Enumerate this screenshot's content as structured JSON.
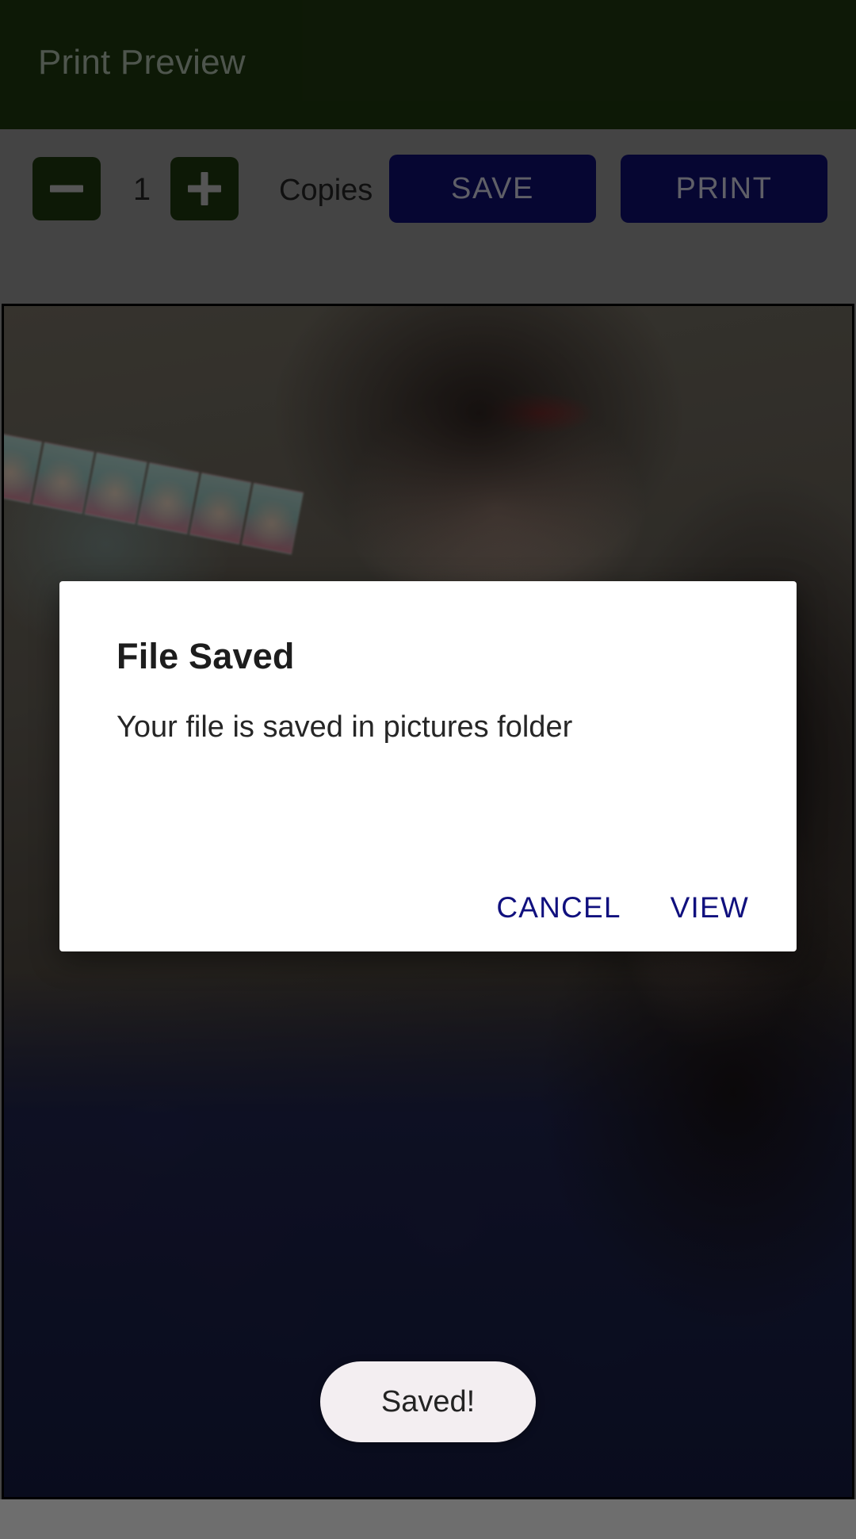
{
  "appbar": {
    "title": "Print Preview",
    "background_color": "#16290b",
    "title_color": "#7e8a7c"
  },
  "toolbar": {
    "background_color": "#6e6e6e",
    "decrement_icon": "minus-icon",
    "increment_icon": "plus-icon",
    "copies_value": "1",
    "copies_label": "Copies",
    "save_label": "SAVE",
    "print_label": "PRINT",
    "button_color": "#0b0b52",
    "button_text_color": "#9a9aa6",
    "stepper_color": "#16290b"
  },
  "preview": {
    "name": "print-preview-image",
    "description": "Portrait photo of a woman in a blue and red sari, with a wall strip of baby photos behind her",
    "border_color": "#000000"
  },
  "dialog": {
    "title": "File Saved",
    "message": "Your file is saved in pictures folder",
    "cancel_label": "CANCEL",
    "view_label": "VIEW",
    "action_color": "#10107e",
    "background_color": "#ffffff"
  },
  "toast": {
    "text": "Saved!",
    "background_color": "#f3eef1",
    "text_color": "#232323"
  }
}
